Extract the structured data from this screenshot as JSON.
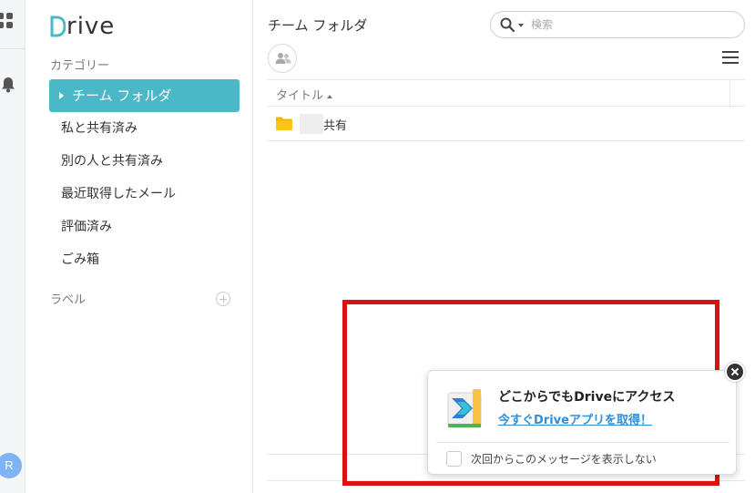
{
  "app": {
    "logo_initial": "D",
    "logo_rest": "rive"
  },
  "rail": {
    "avatar_initial": "R"
  },
  "sidebar": {
    "category_label": "カテゴリー",
    "items": [
      {
        "label": "チーム フォルダ",
        "active": true
      },
      {
        "label": "私と共有済み"
      },
      {
        "label": "別の人と共有済み"
      },
      {
        "label": "最近取得したメール"
      },
      {
        "label": "評価済み"
      },
      {
        "label": "ごみ箱"
      }
    ],
    "label_section": "ラベル"
  },
  "main": {
    "title": "チーム フォルダ",
    "search": {
      "placeholder": "検索"
    },
    "table": {
      "column_title": "タイトル",
      "rows": [
        {
          "name": "共有",
          "icon": "folder-icon"
        }
      ]
    }
  },
  "popup": {
    "headline": "どこからでもDriveにアクセス",
    "link": "今すぐDriveアプリを取得！",
    "checkbox_label": "次回からこのメッセージを表示しない"
  },
  "colors": {
    "accent": "#4ab8c6",
    "link": "#2d8fd8",
    "highlight": "#e01010",
    "folder": "#f5b400"
  }
}
